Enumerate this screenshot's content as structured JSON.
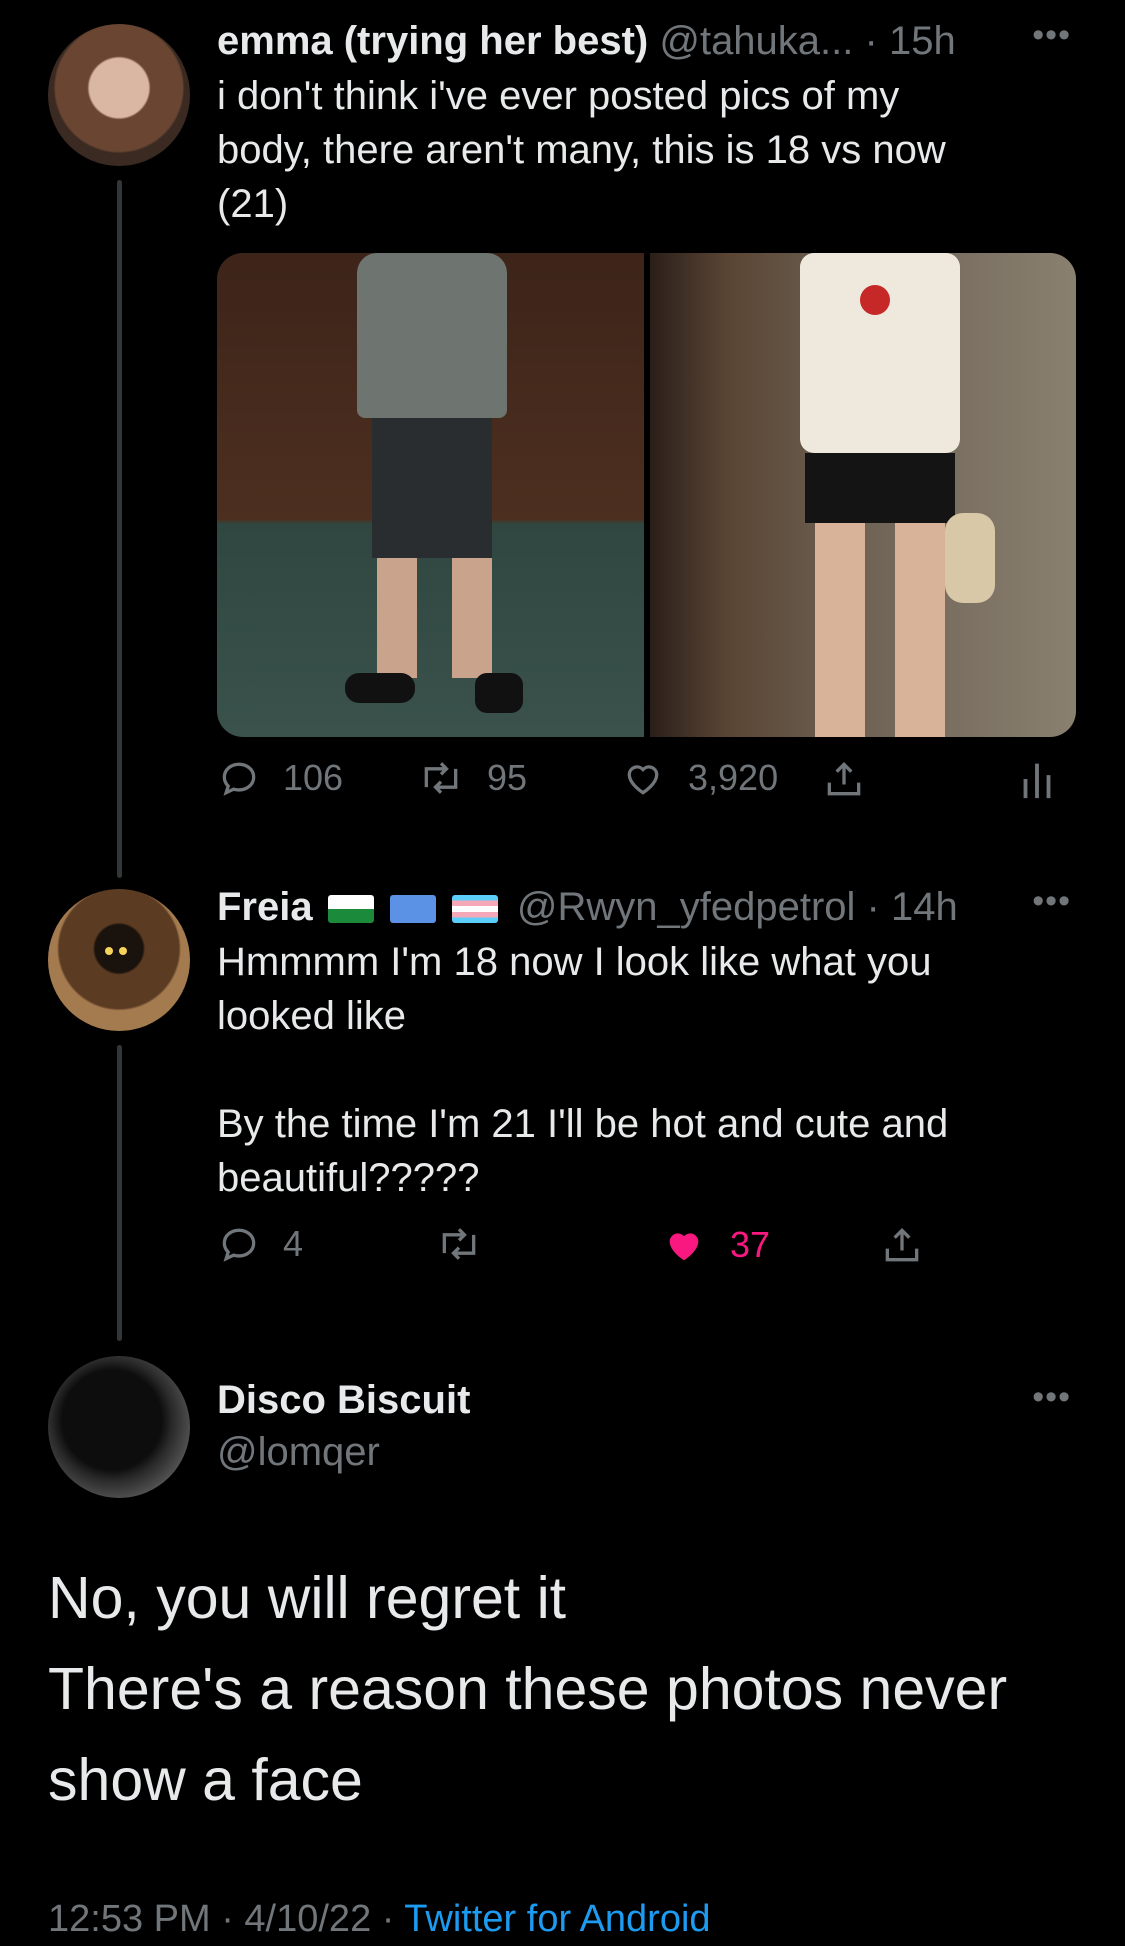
{
  "tweets": [
    {
      "display_name": "emma (trying her best)",
      "handle": "@tahuka...",
      "time": "· 15h",
      "text": "i don't think i've ever posted pics of my\nbody, there aren't many, this is 18 vs now\n(21)",
      "replies": "106",
      "retweets": "95",
      "likes": "3,920"
    },
    {
      "display_name": "Freia",
      "handle": "@Rwyn_yfedpetrol",
      "time": "· 14h",
      "text": "Hmmmm I'm 18 now I look like what you\nlooked like\n\nBy the time I'm 21 I'll be hot and cute and\nbeautiful?????",
      "replies": "4",
      "likes": "37"
    }
  ],
  "main_tweet": {
    "display_name": "Disco Biscuit",
    "handle": "@lomqer",
    "text": "No, you will regret it\nThere's a reason these photos never\nshow a face",
    "timestamp": "12:53 PM · 4/10/22 · ",
    "source": "Twitter for Android"
  },
  "colors": {
    "background": "#000000",
    "text": "#e7e9ea",
    "secondary": "#71767b",
    "like_active": "#f91880",
    "link": "#1d9bf0"
  },
  "icons": [
    "reply-icon",
    "retweet-icon",
    "like-icon",
    "share-icon",
    "analytics-icon",
    "more-icon"
  ]
}
